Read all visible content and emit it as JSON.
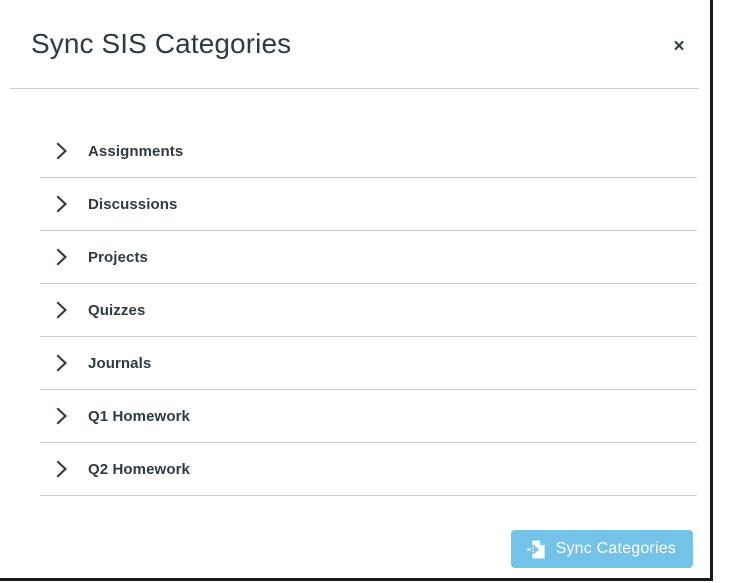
{
  "modal": {
    "title": "Sync SIS Categories",
    "close_label": "×",
    "accent_color": "#73c3e8",
    "text_color": "#2d3b45",
    "divider_color": "#c7cdd1",
    "categories": [
      {
        "label": "Assignments",
        "icon": "chevron-right-icon"
      },
      {
        "label": "Discussions",
        "icon": "chevron-right-icon"
      },
      {
        "label": "Projects",
        "icon": "chevron-right-icon"
      },
      {
        "label": "Quizzes",
        "icon": "chevron-right-icon"
      },
      {
        "label": "Journals",
        "icon": "chevron-right-icon"
      },
      {
        "label": "Q1 Homework",
        "icon": "chevron-right-icon"
      },
      {
        "label": "Q2 Homework",
        "icon": "chevron-right-icon"
      }
    ],
    "footer": {
      "sync_button_label": "Sync Categories",
      "sync_button_icon": "document-import-icon"
    }
  }
}
